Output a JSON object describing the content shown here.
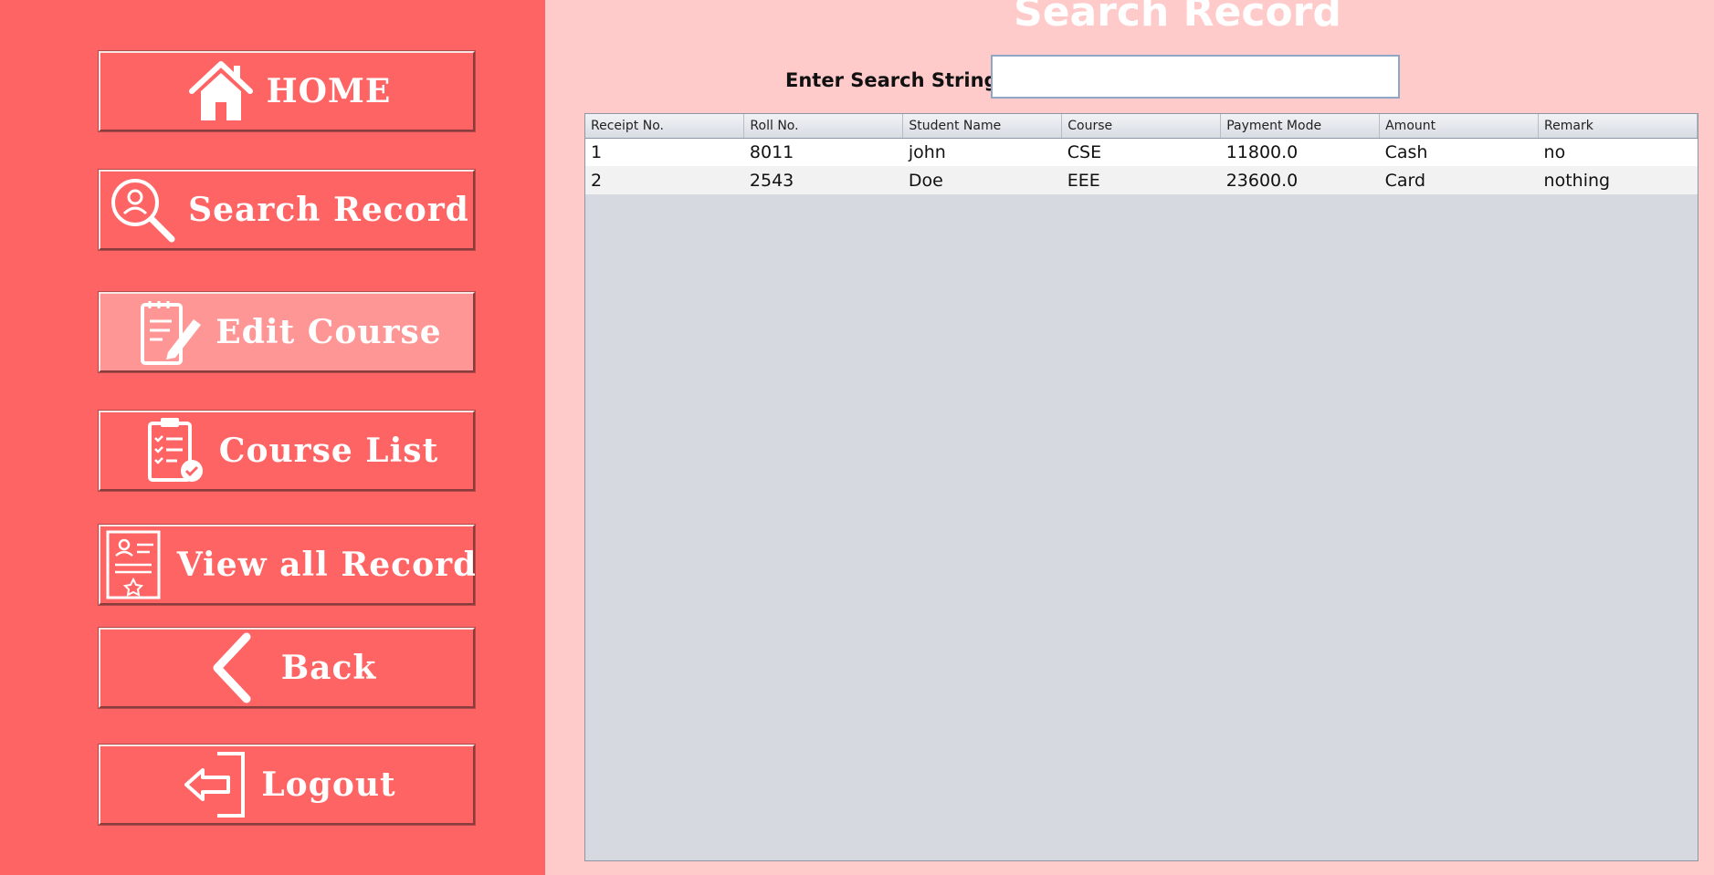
{
  "sidebar": {
    "background": "#ff6464",
    "items": [
      {
        "label": "HOME",
        "icon": "home-icon",
        "active": false
      },
      {
        "label": "Search Record",
        "icon": "search-user-icon",
        "active": false
      },
      {
        "label": "Edit Course",
        "icon": "edit-notepad-icon",
        "active": true
      },
      {
        "label": "Course List",
        "icon": "clipboard-check-icon",
        "active": false
      },
      {
        "label": "View all Record",
        "icon": "id-card-icon",
        "active": false
      },
      {
        "label": "Back",
        "icon": "chevron-left-icon",
        "active": false
      },
      {
        "label": "Logout",
        "icon": "logout-icon",
        "active": false
      }
    ]
  },
  "main": {
    "title": "Search Record",
    "background": "#ffcaca",
    "search": {
      "label": "Enter Search String:",
      "value": ""
    },
    "table": {
      "columns": [
        "Receipt No.",
        "Roll No.",
        "Student Name",
        "Course",
        "Payment Mode",
        "Amount",
        "Remark"
      ],
      "rows": [
        [
          "1",
          "8011",
          "john",
          "CSE",
          "11800.0",
          "Cash",
          "no"
        ],
        [
          "2",
          "2543",
          "Doe",
          "EEE",
          "23600.0",
          "Card",
          "nothing"
        ]
      ]
    }
  }
}
